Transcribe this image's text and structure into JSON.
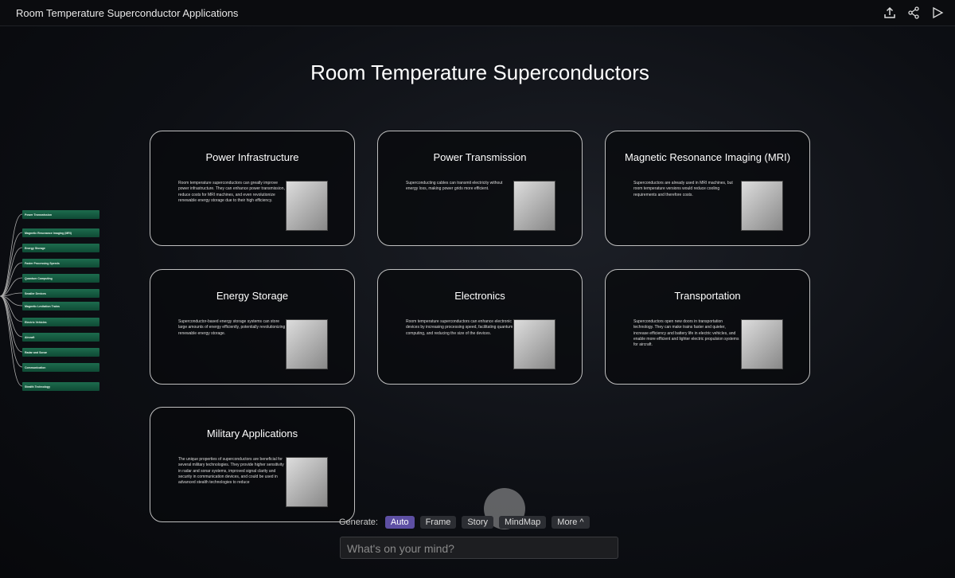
{
  "app_title": "Room Temperature Superconductor Applications",
  "toolbar_icons": [
    "upload-icon",
    "share-icon",
    "play-icon"
  ],
  "main_title": "Room Temperature Superconductors",
  "cards": [
    {
      "title": "Power Infrastructure",
      "text": "Room temperature superconductors can greatly improve power infrastructure. They can enhance power transmission, reduce costs for MRI machines, and even revolutionize renewable energy storage due to their high efficiency."
    },
    {
      "title": "Power Transmission",
      "text": "Superconducting cables can transmit electricity without energy loss, making power grids more efficient."
    },
    {
      "title": "Magnetic Resonance Imaging (MRI)",
      "text": "Superconductors are already used in MRI machines, but room temperature versions would reduce cooling requirements and therefore costs."
    },
    {
      "title": "Energy Storage",
      "text": "Superconductor-based energy storage systems can store large amounts of energy efficiently, potentially revolutionizing renewable energy storage."
    },
    {
      "title": "Electronics",
      "text": "Room temperature superconductors can enhance electronic devices by increasing processing speed, facilitating quantum computing, and reducing the size of the devices."
    },
    {
      "title": "Transportation",
      "text": "Superconductors open new doors in transportation technology. They can make trains faster and quieter, increase efficiency and battery life in electric vehicles, and enable more efficient and lighter electric propulsion systems for aircraft."
    },
    {
      "title": "Military Applications",
      "text": "The unique properties of superconductors are beneficial for several military technologies. They provide higher sensitivity in radar and sonar systems, improved signal clarity and security in communication devices, and could be used in advanced stealth technologies to reduce"
    }
  ],
  "mindmap_nodes": [
    "Power Transmission",
    "Magnetic Resonance Imaging (MRI)",
    "Energy Storage",
    "Faster Processing Speeds",
    "Quantum Computing",
    "Smaller Devices",
    "Magnetic Levitation Trains",
    "Electric Vehicles",
    "Aircraft",
    "Radar and Sonar",
    "Communication",
    "Stealth Technology"
  ],
  "generate": {
    "label": "Generate:",
    "options": [
      "Auto",
      "Frame",
      "Story",
      "MindMap",
      "More ^"
    ],
    "active": "Auto"
  },
  "input": {
    "placeholder": "What's on your mind?"
  },
  "colors": {
    "accent": "#5d4fa3",
    "node": "#1d6b4d"
  }
}
